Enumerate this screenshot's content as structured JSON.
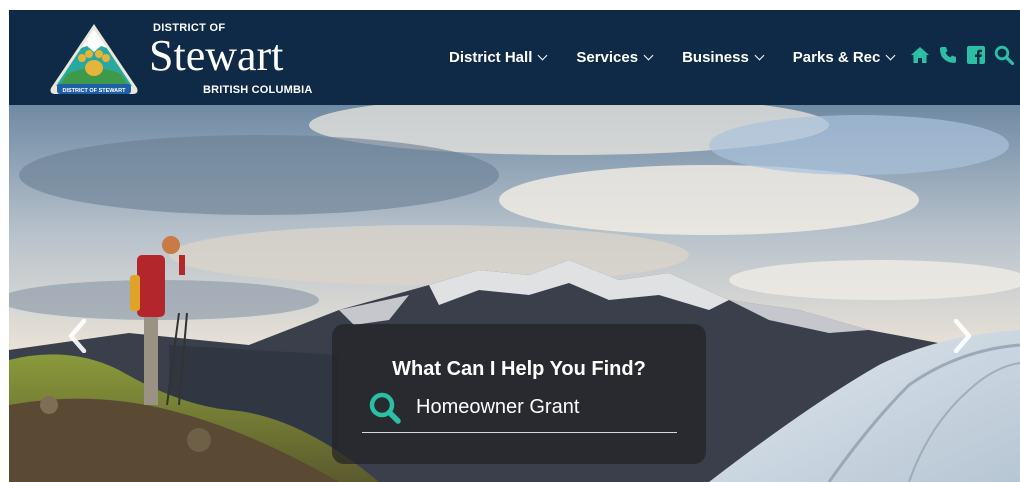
{
  "header": {
    "logo": {
      "badge_text": "DISTRICT OF STEWART",
      "district_label": "DISTRICT OF",
      "name": "Stewart",
      "province": "BRITISH COLUMBIA"
    },
    "nav": [
      {
        "label": "District Hall"
      },
      {
        "label": "Services"
      },
      {
        "label": "Business"
      },
      {
        "label": "Parks & Rec"
      }
    ],
    "icons": [
      "home-icon",
      "phone-icon",
      "facebook-icon",
      "search-icon"
    ],
    "colors": {
      "bar": "#0f2a47",
      "icon": "#2bbfa5"
    }
  },
  "hero": {
    "search": {
      "title": "What Can I Help You Find?",
      "placeholder": "Homeowner Grant"
    },
    "arrows": [
      "chevron-left-icon",
      "chevron-right-icon"
    ]
  }
}
